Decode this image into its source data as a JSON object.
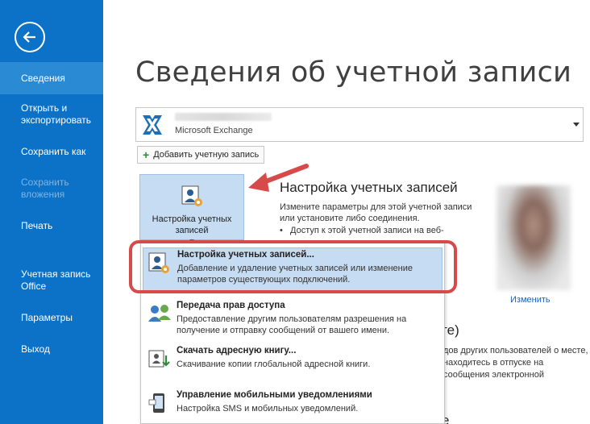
{
  "nav": {
    "back": "back",
    "items": [
      {
        "label": "Сведения",
        "active": true
      },
      {
        "label": "Открыть и экспортировать"
      },
      {
        "label": "Сохранить как"
      },
      {
        "label": "Сохранить вложения",
        "disabled": true
      },
      {
        "label": "Печать"
      },
      {
        "label": "Учетная запись Office"
      },
      {
        "label": "Параметры"
      },
      {
        "label": "Выход"
      }
    ]
  },
  "main": {
    "title": "Сведения об учетной записи",
    "account": {
      "type": "Microsoft Exchange"
    },
    "add_account_label": "Добавить учетную запись",
    "settings_button_label": "Настройка учетных записей",
    "settings_button_arrow": "▾",
    "section_title": "Настройка учетных записей",
    "section_desc": "Измените параметры для этой учетной записи или установите либо соединения.",
    "section_bullet": "Доступ к этой учетной записи на веб-",
    "change_link": "Изменить",
    "bg_heading_fragment": "оте)",
    "bg_text": "дов других пользователей о месте, находитесь в отпуске на сообщения электронной",
    "bg_heading_bottom": "е"
  },
  "menu": {
    "items": [
      {
        "title": "Настройка учетных записей...",
        "desc": "Добавление и удаление учетных записей или изменение параметров существующих подключений."
      },
      {
        "title": "Передача прав доступа",
        "desc": "Предоставление другим пользователям разрешения на получение и отправку сообщений от вашего имени."
      },
      {
        "title": "Скачать адресную книгу...",
        "desc": "Скачивание копии глобальной адресной книги."
      },
      {
        "title": "Управление мобильными уведомлениями",
        "desc": "Настройка SMS и мобильных уведомлений."
      }
    ]
  },
  "colors": {
    "nav_bg": "#0b72c7",
    "nav_active": "#2a8ad4",
    "highlight": "#c5dcf2",
    "annotation": "#d64a4a"
  }
}
